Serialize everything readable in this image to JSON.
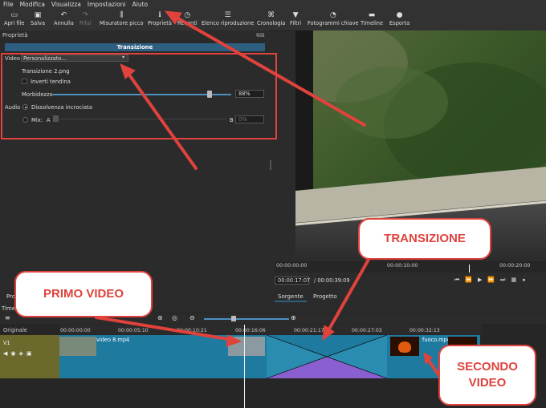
{
  "menu": [
    "File",
    "Modifica",
    "Visualizza",
    "Impostazioni",
    "Aiuto"
  ],
  "toolbar": [
    {
      "label": "Apri file",
      "icon": "folder-icon",
      "dim": false
    },
    {
      "label": "Salva",
      "icon": "save-icon",
      "dim": false
    },
    {
      "label": "Annulla",
      "icon": "undo-icon",
      "dim": false
    },
    {
      "label": "Rifai",
      "icon": "redo-icon",
      "dim": true
    },
    {
      "label": "Misuratore picco",
      "icon": "meter-icon",
      "dim": false
    },
    {
      "label": "Proprietà",
      "icon": "info-icon",
      "dim": false
    },
    {
      "label": "Recenti",
      "icon": "clock-icon",
      "dim": false
    },
    {
      "label": "Elenco riproduzione",
      "icon": "list-icon",
      "dim": false
    },
    {
      "label": "Cronologia",
      "icon": "history-icon",
      "dim": false
    },
    {
      "label": "Filtri",
      "icon": "filter-icon",
      "dim": false
    },
    {
      "label": "Fotogrammi chiave",
      "icon": "keyframe-icon",
      "dim": false
    },
    {
      "label": "Timeline",
      "icon": "timeline-icon",
      "dim": false
    },
    {
      "label": "Esporta",
      "icon": "export-icon",
      "dim": false
    }
  ],
  "properties": {
    "panel_title": "Proprietà",
    "header": "Transizione",
    "video_label": "Video",
    "video_value": "Personalizzato...",
    "transition_file": "Transizione 2.png",
    "invert_label": "Inverti tendina",
    "softness_label": "Morbidezza",
    "softness_value": "88%",
    "softness_level": 0.88,
    "audio_label": "Audio",
    "crossfade_label": "Dissolvenza incrociata",
    "mix_label": "Mix:",
    "mix_a": "A",
    "mix_b": "B",
    "mix_value": "0%"
  },
  "player": {
    "ruler_ticks": [
      "00:00:00:00",
      "00:00:10:00",
      "00:00:20:00"
    ],
    "current_time": "00:00:17:07",
    "total_time": "/ 00:00:39:09",
    "tabs": [
      "Sorgente",
      "Progetto"
    ]
  },
  "left_tabs": [
    "Pro",
    "Time"
  ],
  "timeline": {
    "track_original": "Originale",
    "track_name": "V1",
    "ticks": [
      "00:00:00:00",
      "00:00:05:10",
      "00:00:10:21",
      "00:00:16:06",
      "00:00:21:17",
      "00:00:27:03",
      "00:00:32:13"
    ],
    "clips": [
      {
        "name": "video 8.mp4"
      },
      {
        "name": "fuoco.mp4"
      }
    ]
  },
  "annotations": {
    "transizione": "TRANSIZIONE",
    "primo_video": "PRIMO VIDEO",
    "secondo_video_1": "SECONDO",
    "secondo_video_2": "VIDEO"
  },
  "colors": {
    "accent": "#2e5e80",
    "annotation": "#e0423c",
    "clip": "#1f7aa0",
    "transition": "#8a5fd0"
  }
}
